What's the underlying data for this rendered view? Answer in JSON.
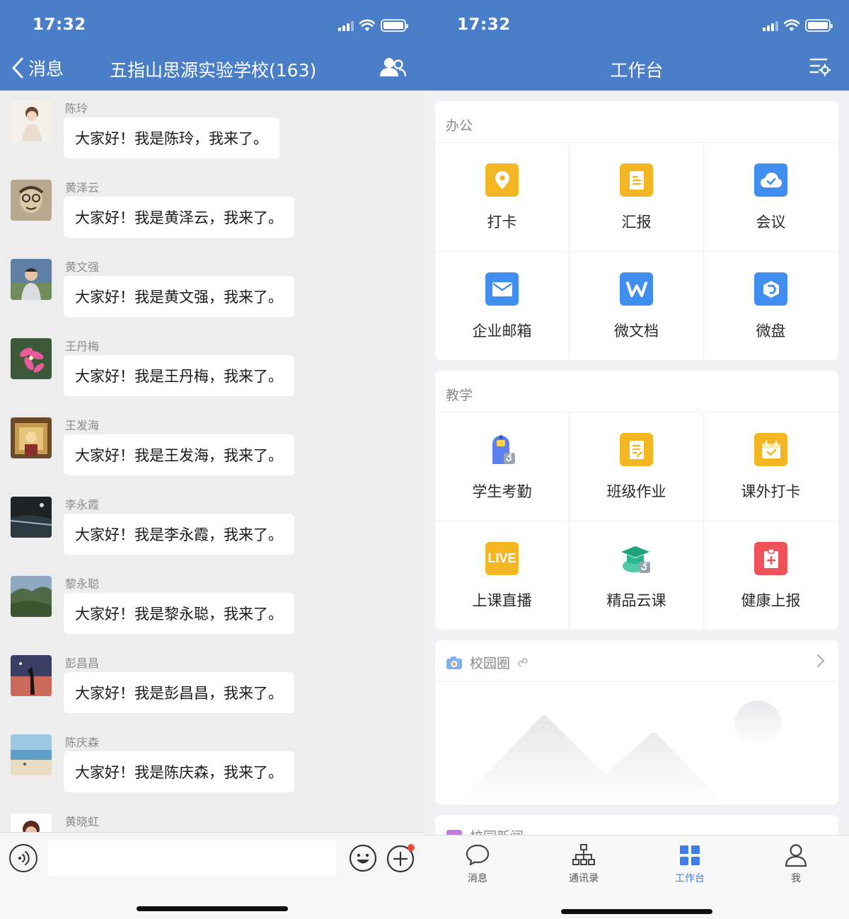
{
  "colors": {
    "header": "#4a7ec8",
    "accent": "#3f7ee8",
    "icon_yellow": "#f5b623",
    "icon_blue": "#3f8ef0",
    "icon_red": "#f0525a"
  },
  "chat": {
    "status_time": "17:32",
    "back_label": "消息",
    "title": "五指山思源实验学校(163)",
    "members_icon": "group-members-icon",
    "messages": [
      {
        "sender": "陈玲",
        "text": "大家好！我是陈玲，我来了。"
      },
      {
        "sender": "黄泽云",
        "text": "大家好！我是黄泽云，我来了。"
      },
      {
        "sender": "黄文强",
        "text": "大家好！我是黄文强，我来了。"
      },
      {
        "sender": "王丹梅",
        "text": "大家好！我是王丹梅，我来了。"
      },
      {
        "sender": "王发海",
        "text": "大家好！我是王发海，我来了。"
      },
      {
        "sender": "李永霞",
        "text": "大家好！我是李永霞，我来了。"
      },
      {
        "sender": "黎永聪",
        "text": "大家好！我是黎永聪，我来了。"
      },
      {
        "sender": "彭昌昌",
        "text": "大家好！我是彭昌昌，我来了。"
      },
      {
        "sender": "陈庆森",
        "text": "大家好！我是陈庆森，我来了。"
      },
      {
        "sender": "黄晓虹",
        "text": ""
      }
    ],
    "input_placeholder": ""
  },
  "workbench": {
    "status_time": "17:32",
    "title": "工作台",
    "office": {
      "title": "办公",
      "items": [
        {
          "label": "打卡",
          "icon": "location-pin-icon"
        },
        {
          "label": "汇报",
          "icon": "report-icon"
        },
        {
          "label": "会议",
          "icon": "cloud-meeting-icon"
        },
        {
          "label": "企业邮箱",
          "icon": "mail-icon"
        },
        {
          "label": "微文档",
          "icon": "word-doc-icon"
        },
        {
          "label": "微盘",
          "icon": "drive-icon"
        }
      ]
    },
    "teaching": {
      "title": "教学",
      "items": [
        {
          "label": "学生考勤",
          "icon": "student-attendance-icon"
        },
        {
          "label": "班级作业",
          "icon": "homework-icon"
        },
        {
          "label": "课外打卡",
          "icon": "calendar-check-icon"
        },
        {
          "label": "上课直播",
          "icon": "live-icon",
          "badge": "LIVE"
        },
        {
          "label": "精品云课",
          "icon": "graduation-cap-icon"
        },
        {
          "label": "健康上报",
          "icon": "health-report-icon"
        }
      ]
    },
    "campus": {
      "title": "校园圈"
    },
    "next_card_title": "校园新闻"
  },
  "tabs": [
    {
      "label": "消息",
      "icon": "chat-bubble-icon"
    },
    {
      "label": "通讯录",
      "icon": "org-chart-icon"
    },
    {
      "label": "工作台",
      "icon": "grid-icon",
      "active": true
    },
    {
      "label": "我",
      "icon": "person-icon"
    }
  ]
}
